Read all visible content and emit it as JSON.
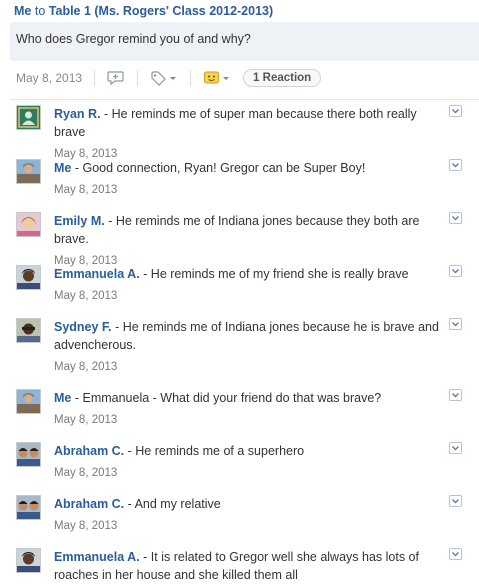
{
  "post": {
    "author": "Me",
    "to_word": "to",
    "group": "Table 1 (Ms. Rogers' Class 2012-2013)",
    "question": "Who does Gregor remind you of and why?",
    "date": "May 8, 2013",
    "reaction_label": "1 Reaction"
  },
  "colors": {
    "link": "#2a5d9b",
    "question_bg": "#eef1f6",
    "date": "#7a7a7a"
  },
  "icons": [
    "reply-icon",
    "tag-icon",
    "reaction-icon",
    "chevron-down-icon"
  ],
  "replies": [
    {
      "name": "Ryan R.",
      "text": " - He reminds me of super man because there both really brave",
      "date": "May 8, 2013",
      "avatar": "default-avatar"
    },
    {
      "name": "Me",
      "text": " - Good connection, Ryan! Gregor can be Super Boy!",
      "date": "May 8, 2013",
      "avatar": "photo-avatar"
    },
    {
      "name": "Emily M.",
      "text": " - He reminds me of Indiana jones because they both are brave.",
      "date": "May 8, 2013",
      "avatar": "photo-avatar"
    },
    {
      "name": "Emmanuela A.",
      "text": " - He reminds me of my friend she is really brave",
      "date": "May 8, 2013",
      "avatar": "photo-avatar"
    },
    {
      "name": "Sydney F.",
      "text": " - He reminds me of Indiana jones because he is brave and advencherous.",
      "date": "May 8, 2013",
      "avatar": "photo-avatar"
    },
    {
      "name": "Me",
      "text": " - Emmanuela - What did your friend do that was brave?",
      "date": "May 8, 2013",
      "avatar": "photo-avatar"
    },
    {
      "name": "Abraham C.",
      "text": " - He reminds me of a superhero",
      "date": "May 8, 2013",
      "avatar": "photo-avatar"
    },
    {
      "name": "Abraham C.",
      "text": " - And my relative",
      "date": "May 8, 2013",
      "avatar": "photo-avatar"
    },
    {
      "name": "Emmanuela A.",
      "text": " - It is related to Gregor well she always has lots of roaches in her house and she killed them all",
      "date": "",
      "avatar": "photo-avatar"
    }
  ]
}
